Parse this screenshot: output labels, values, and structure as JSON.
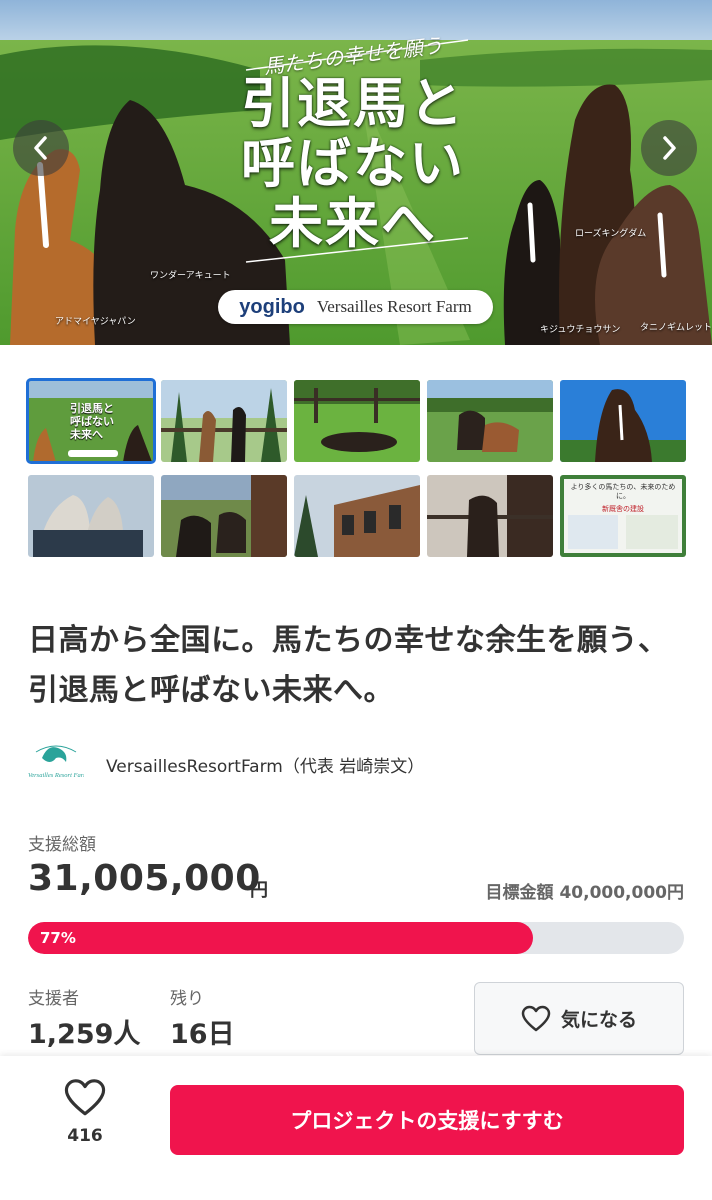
{
  "hero": {
    "subtitle": "馬たちの幸せを願う",
    "title_lines": [
      "引退馬と",
      "呼ばない",
      "未来へ"
    ],
    "brand_logo": "yogibo",
    "brand_name": "Versailles Resort Farm",
    "horse_names": [
      "アドマイヤジャパン",
      "ワンダーアキュート",
      "ローズキングダム",
      "キジュウチョウサン",
      "タニノギムレット"
    ],
    "prev_icon": "chevron-left-icon",
    "next_icon": "chevron-right-icon"
  },
  "thumbnails": {
    "count": 10,
    "active_index": 0,
    "first_thumb_text": [
      "引退馬と",
      "呼ばない",
      "未来へ"
    ],
    "last_thumb_text": [
      "より多くの馬たちの、未来のために。",
      "新厩舎の建設"
    ]
  },
  "project": {
    "title": "日高から全国に。馬たちの幸せな余生を願う、引退馬と呼ばない未来へ。",
    "owner": "VersaillesResortFarm（代表 岩崎崇文）",
    "owner_logo_text": "Versailles Resort Farm"
  },
  "stats": {
    "total_label": "支援総額",
    "total_value": "31,005,000",
    "total_unit": "円",
    "goal_label": "目標金額",
    "goal_value": "40,000,000円",
    "progress_percent": 77,
    "progress_text": "77%",
    "supporters_label": "支援者",
    "supporters_value": "1,259人",
    "remaining_label": "残り",
    "remaining_value": "16日"
  },
  "actions": {
    "watch_label": "気になる",
    "watch_icon": "heart-outline-icon",
    "like_count": "416",
    "like_icon": "heart-outline-icon",
    "support_label": "プロジェクトの支援にすすむ"
  },
  "colors": {
    "accent": "#f0144d",
    "active_thumb_border": "#1f6fd6",
    "progress_track": "#e3e6ea"
  }
}
